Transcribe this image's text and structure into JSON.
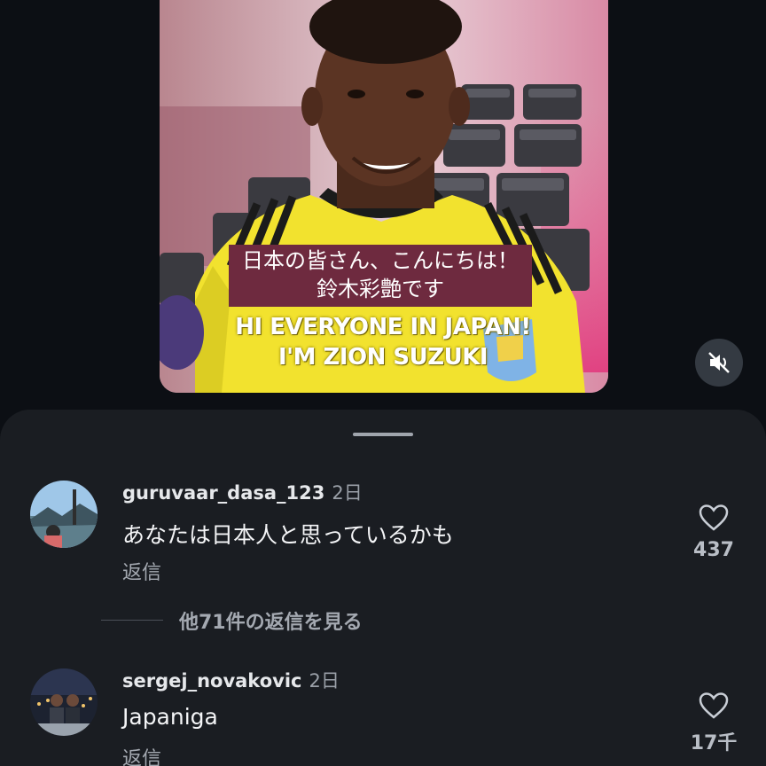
{
  "video": {
    "subtitle_jp_line1": "日本の皆さん、こんにちは！",
    "subtitle_jp_line2": "鈴木彩艶です",
    "subtitle_en_line1": "HI EVERYONE IN JAPAN!",
    "subtitle_en_line2": "I'M ZION SUZUKI",
    "mute_icon": "speaker-muted-icon"
  },
  "comments": [
    {
      "username": "guruvaar_dasa_123",
      "time": "2日",
      "text": "あなたは日本人と思っているかも",
      "reply_label": "返信",
      "likes": "437",
      "view_replies": "他71件の返信を見る"
    },
    {
      "username": "sergej_novakovic",
      "time": "2日",
      "text": "Japaniga",
      "reply_label": "返信",
      "likes": "17千"
    }
  ],
  "colors": {
    "background": "#0c0f14",
    "sheet": "#1a1d22",
    "subtitle_box": "#6e2a3f",
    "jersey_yellow": "#f2e22e"
  }
}
